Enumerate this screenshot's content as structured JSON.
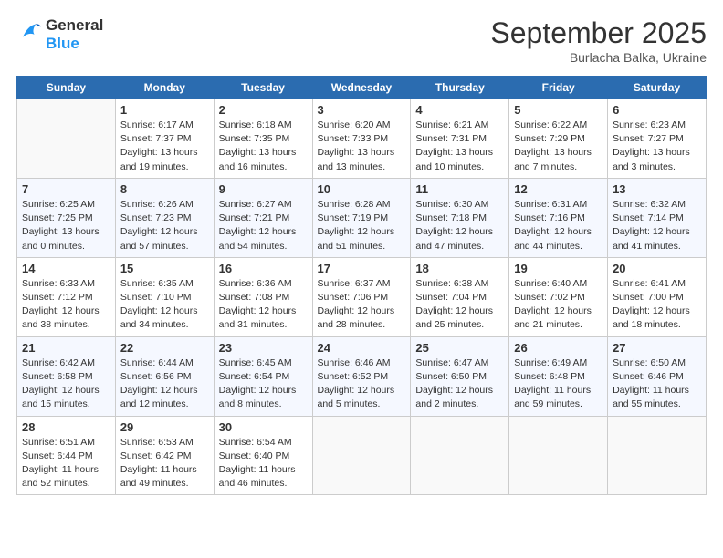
{
  "header": {
    "logo_line1": "General",
    "logo_line2": "Blue",
    "month_title": "September 2025",
    "location": "Burlacha Balka, Ukraine"
  },
  "columns": [
    "Sunday",
    "Monday",
    "Tuesday",
    "Wednesday",
    "Thursday",
    "Friday",
    "Saturday"
  ],
  "weeks": [
    [
      {
        "day": "",
        "info": ""
      },
      {
        "day": "1",
        "info": "Sunrise: 6:17 AM\nSunset: 7:37 PM\nDaylight: 13 hours\nand 19 minutes."
      },
      {
        "day": "2",
        "info": "Sunrise: 6:18 AM\nSunset: 7:35 PM\nDaylight: 13 hours\nand 16 minutes."
      },
      {
        "day": "3",
        "info": "Sunrise: 6:20 AM\nSunset: 7:33 PM\nDaylight: 13 hours\nand 13 minutes."
      },
      {
        "day": "4",
        "info": "Sunrise: 6:21 AM\nSunset: 7:31 PM\nDaylight: 13 hours\nand 10 minutes."
      },
      {
        "day": "5",
        "info": "Sunrise: 6:22 AM\nSunset: 7:29 PM\nDaylight: 13 hours\nand 7 minutes."
      },
      {
        "day": "6",
        "info": "Sunrise: 6:23 AM\nSunset: 7:27 PM\nDaylight: 13 hours\nand 3 minutes."
      }
    ],
    [
      {
        "day": "7",
        "info": "Sunrise: 6:25 AM\nSunset: 7:25 PM\nDaylight: 13 hours\nand 0 minutes."
      },
      {
        "day": "8",
        "info": "Sunrise: 6:26 AM\nSunset: 7:23 PM\nDaylight: 12 hours\nand 57 minutes."
      },
      {
        "day": "9",
        "info": "Sunrise: 6:27 AM\nSunset: 7:21 PM\nDaylight: 12 hours\nand 54 minutes."
      },
      {
        "day": "10",
        "info": "Sunrise: 6:28 AM\nSunset: 7:19 PM\nDaylight: 12 hours\nand 51 minutes."
      },
      {
        "day": "11",
        "info": "Sunrise: 6:30 AM\nSunset: 7:18 PM\nDaylight: 12 hours\nand 47 minutes."
      },
      {
        "day": "12",
        "info": "Sunrise: 6:31 AM\nSunset: 7:16 PM\nDaylight: 12 hours\nand 44 minutes."
      },
      {
        "day": "13",
        "info": "Sunrise: 6:32 AM\nSunset: 7:14 PM\nDaylight: 12 hours\nand 41 minutes."
      }
    ],
    [
      {
        "day": "14",
        "info": "Sunrise: 6:33 AM\nSunset: 7:12 PM\nDaylight: 12 hours\nand 38 minutes."
      },
      {
        "day": "15",
        "info": "Sunrise: 6:35 AM\nSunset: 7:10 PM\nDaylight: 12 hours\nand 34 minutes."
      },
      {
        "day": "16",
        "info": "Sunrise: 6:36 AM\nSunset: 7:08 PM\nDaylight: 12 hours\nand 31 minutes."
      },
      {
        "day": "17",
        "info": "Sunrise: 6:37 AM\nSunset: 7:06 PM\nDaylight: 12 hours\nand 28 minutes."
      },
      {
        "day": "18",
        "info": "Sunrise: 6:38 AM\nSunset: 7:04 PM\nDaylight: 12 hours\nand 25 minutes."
      },
      {
        "day": "19",
        "info": "Sunrise: 6:40 AM\nSunset: 7:02 PM\nDaylight: 12 hours\nand 21 minutes."
      },
      {
        "day": "20",
        "info": "Sunrise: 6:41 AM\nSunset: 7:00 PM\nDaylight: 12 hours\nand 18 minutes."
      }
    ],
    [
      {
        "day": "21",
        "info": "Sunrise: 6:42 AM\nSunset: 6:58 PM\nDaylight: 12 hours\nand 15 minutes."
      },
      {
        "day": "22",
        "info": "Sunrise: 6:44 AM\nSunset: 6:56 PM\nDaylight: 12 hours\nand 12 minutes."
      },
      {
        "day": "23",
        "info": "Sunrise: 6:45 AM\nSunset: 6:54 PM\nDaylight: 12 hours\nand 8 minutes."
      },
      {
        "day": "24",
        "info": "Sunrise: 6:46 AM\nSunset: 6:52 PM\nDaylight: 12 hours\nand 5 minutes."
      },
      {
        "day": "25",
        "info": "Sunrise: 6:47 AM\nSunset: 6:50 PM\nDaylight: 12 hours\nand 2 minutes."
      },
      {
        "day": "26",
        "info": "Sunrise: 6:49 AM\nSunset: 6:48 PM\nDaylight: 11 hours\nand 59 minutes."
      },
      {
        "day": "27",
        "info": "Sunrise: 6:50 AM\nSunset: 6:46 PM\nDaylight: 11 hours\nand 55 minutes."
      }
    ],
    [
      {
        "day": "28",
        "info": "Sunrise: 6:51 AM\nSunset: 6:44 PM\nDaylight: 11 hours\nand 52 minutes."
      },
      {
        "day": "29",
        "info": "Sunrise: 6:53 AM\nSunset: 6:42 PM\nDaylight: 11 hours\nand 49 minutes."
      },
      {
        "day": "30",
        "info": "Sunrise: 6:54 AM\nSunset: 6:40 PM\nDaylight: 11 hours\nand 46 minutes."
      },
      {
        "day": "",
        "info": ""
      },
      {
        "day": "",
        "info": ""
      },
      {
        "day": "",
        "info": ""
      },
      {
        "day": "",
        "info": ""
      }
    ]
  ]
}
